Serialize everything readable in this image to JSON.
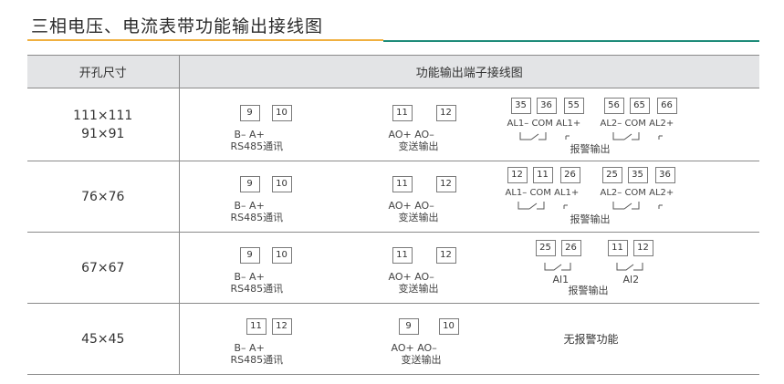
{
  "title": "三相电压、电流表带功能输出接线图",
  "header": {
    "col1": "开孔尺寸",
    "col2": "功能输出端子接线图"
  },
  "rows": [
    {
      "size_lines": [
        "111×111",
        "91×91"
      ],
      "rs485": {
        "t1": "9",
        "t2": "10",
        "label": "B–  A+",
        "caption": "RS485通讯"
      },
      "ao": {
        "t1": "11",
        "t2": "12",
        "label": "AO+  AO–",
        "caption": "变送输出"
      },
      "alarm": {
        "terms": [
          "35",
          "36",
          "55",
          "56",
          "65",
          "66"
        ],
        "labels_left": "AL1– COM  AL1+",
        "labels_right": "AL2– COM  AL2+",
        "caption": "报警输出"
      }
    },
    {
      "size_lines": [
        "76×76"
      ],
      "rs485": {
        "t1": "9",
        "t2": "10",
        "label": "B–  A+",
        "caption": "RS485通讯"
      },
      "ao": {
        "t1": "11",
        "t2": "12",
        "label": "AO+  AO–",
        "caption": "变送输出"
      },
      "alarm": {
        "terms": [
          "12",
          "11",
          "26",
          "25",
          "35",
          "36"
        ],
        "labels_left": "AL1– COM  AL1+",
        "labels_right": "AL2– COM  AL2+",
        "caption": "报警输出"
      }
    },
    {
      "size_lines": [
        "67×67"
      ],
      "rs485": {
        "t1": "9",
        "t2": "10",
        "label": "B–  A+",
        "caption": "RS485通讯"
      },
      "ao": {
        "t1": "11",
        "t2": "12",
        "label": "AO+  AO–",
        "caption": "变送输出"
      },
      "alarm": {
        "terms": [
          "25",
          "26",
          "11",
          "12"
        ],
        "label_a": "Al1",
        "label_b": "Al2",
        "caption": "报警输出"
      }
    },
    {
      "size_lines": [
        "45×45"
      ],
      "rs485": {
        "t1": "11",
        "t2": "12",
        "label": "B–  A+",
        "caption": "RS485通讯"
      },
      "ao": {
        "t1": "9",
        "t2": "10",
        "label": "AO+  AO–",
        "caption": "变送输出"
      },
      "alarm_text": "无报警功能"
    }
  ]
}
